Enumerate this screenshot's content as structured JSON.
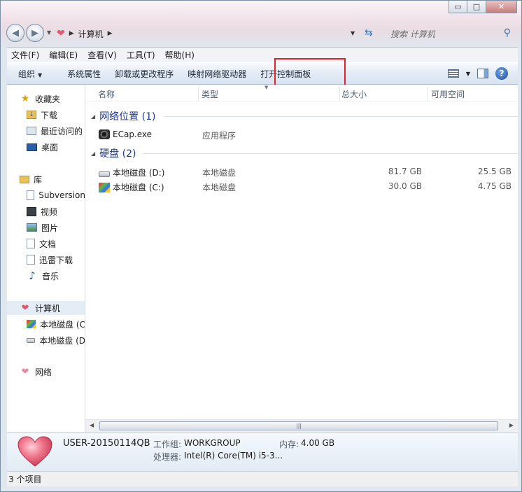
{
  "window": {
    "caption": {
      "minimize": "▭",
      "maximize": "□",
      "close": "✕"
    }
  },
  "address": {
    "crumbs": [
      "计算机"
    ],
    "search_placeholder": "搜索 计算机"
  },
  "menubar": {
    "items": [
      "文件(F)",
      "编辑(E)",
      "查看(V)",
      "工具(T)",
      "帮助(H)"
    ]
  },
  "toolbar": {
    "organize": "组织",
    "buttons": [
      "系统属性",
      "卸载或更改程序",
      "映射网络驱动器",
      "打开控制面板"
    ]
  },
  "navpane": {
    "favorites": {
      "label": "收藏夹",
      "items": [
        "下载",
        "最近访问的",
        "桌面"
      ]
    },
    "libraries": {
      "label": "库",
      "items": [
        "Subversion",
        "视频",
        "图片",
        "文档",
        "迅雷下载",
        "音乐"
      ]
    },
    "computer": {
      "label": "计算机",
      "items": [
        "本地磁盘 (C",
        "本地磁盘 (D"
      ]
    },
    "network": {
      "label": "网络"
    }
  },
  "columns": [
    "名称",
    "类型",
    "总大小",
    "可用空间"
  ],
  "groups": {
    "network": {
      "title": "网络位置 (1)",
      "rows": [
        {
          "name": "ECap.exe",
          "type": "应用程序",
          "total": "",
          "free": ""
        }
      ]
    },
    "disks": {
      "title": "硬盘 (2)",
      "rows": [
        {
          "name": "本地磁盘 (D:)",
          "type": "本地磁盘",
          "total": "81.7 GB",
          "free": "25.5 GB"
        },
        {
          "name": "本地磁盘 (C:)",
          "type": "本地磁盘",
          "total": "30.0 GB",
          "free": "4.75 GB"
        }
      ]
    }
  },
  "details": {
    "computer_name": "USER-20150114QB",
    "workgroup_label": "工作组:",
    "workgroup_value": "WORKGROUP",
    "memory_label": "内存:",
    "memory_value": "4.00 GB",
    "cpu_label": "处理器:",
    "cpu_value": "Intel(R) Core(TM) i5-3..."
  },
  "statusbar": {
    "text": "3 个项目"
  },
  "colors": {
    "highlight": "#e0242b",
    "group_text": "#1e3a8a",
    "heart": "#e2566f"
  }
}
